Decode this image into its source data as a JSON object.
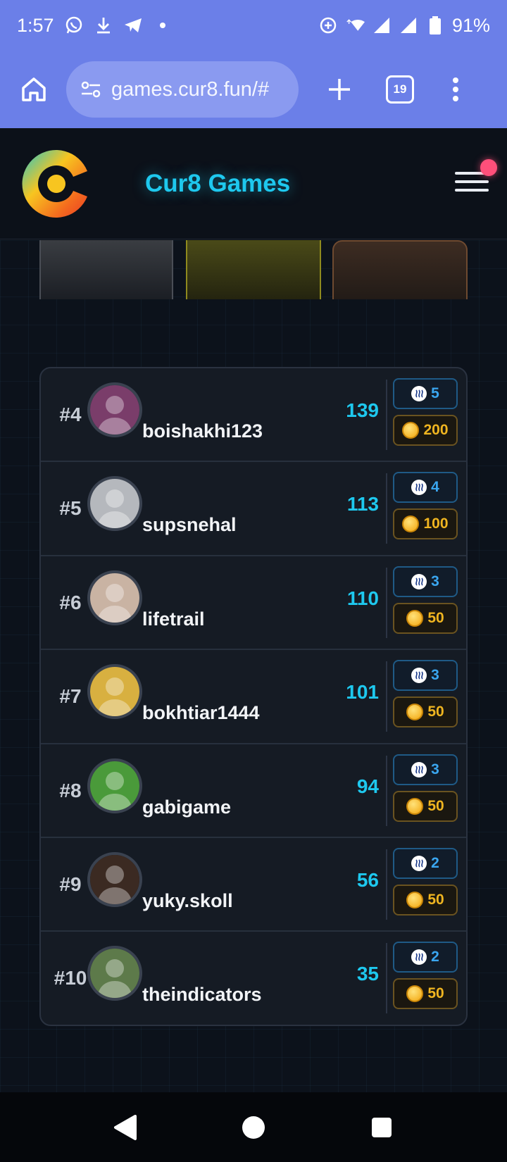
{
  "status_bar": {
    "time": "1:57",
    "battery": "91%"
  },
  "browser": {
    "url": "games.cur8.fun/#",
    "tab_count": "19"
  },
  "app": {
    "title": "Cur8 Games",
    "accent": "#1ec8ee",
    "notification_color": "#ff4f7a"
  },
  "leaderboard": {
    "rows": [
      {
        "rank": "#4",
        "username": "boishakhi123",
        "score": "139",
        "steem": "5",
        "coins": "200",
        "avatar_color": "#7a3d6a"
      },
      {
        "rank": "#5",
        "username": "supsnehal",
        "score": "113",
        "steem": "4",
        "coins": "100",
        "avatar_color": "#b5b8bd"
      },
      {
        "rank": "#6",
        "username": "lifetrail",
        "score": "110",
        "steem": "3",
        "coins": "50",
        "avatar_color": "#c9b3a3"
      },
      {
        "rank": "#7",
        "username": "bokhtiar1444",
        "score": "101",
        "steem": "3",
        "coins": "50",
        "avatar_color": "#d8b040"
      },
      {
        "rank": "#8",
        "username": "gabigame",
        "score": "94",
        "steem": "3",
        "coins": "50",
        "avatar_color": "#4a9a3a"
      },
      {
        "rank": "#9",
        "username": "yuky.skoll",
        "score": "56",
        "steem": "2",
        "coins": "50",
        "avatar_color": "#3b2a22"
      },
      {
        "rank": "#10",
        "username": "theindicators",
        "score": "35",
        "steem": "2",
        "coins": "50",
        "avatar_color": "#5d7a4a"
      }
    ]
  }
}
